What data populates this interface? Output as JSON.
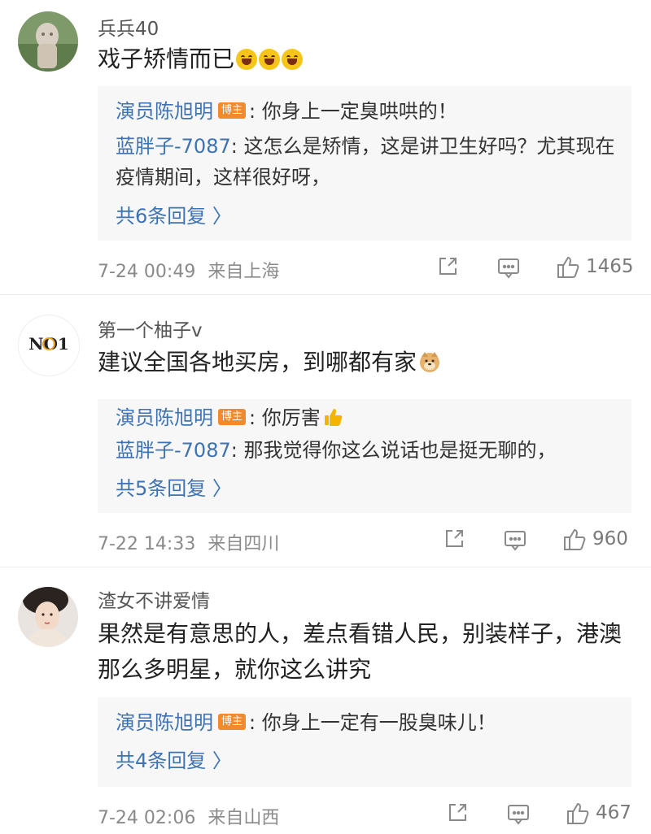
{
  "comments": [
    {
      "username": "兵兵40",
      "text": "戏子矫情而已",
      "emojis": [
        "laughing-face-icon",
        "laughing-face-icon",
        "laughing-face-icon"
      ],
      "replies": [
        {
          "author": "演员陈旭明",
          "badge": "博主",
          "text": "你身上一定臭哄哄的！"
        },
        {
          "author": "蓝胖子-7087",
          "text": "这怎么是矫情，这是讲卫生好吗？尤其现在疫情期间，这样很好呀，"
        }
      ],
      "more_replies": "共6条回复 〉",
      "time": "7-24 00:49",
      "location": "来自上海",
      "likes": "1465"
    },
    {
      "username": "第一个柚子v",
      "text": "建议全国各地买房，到哪都有家",
      "emojis": [
        "doge-icon"
      ],
      "replies": [
        {
          "author": "演员陈旭明",
          "badge": "博主",
          "text": "你厉害",
          "emoji": "thumbs-up-icon"
        },
        {
          "author": "蓝胖子-7087",
          "text": "那我觉得你这么说话也是挺无聊的，"
        }
      ],
      "more_replies": "共5条回复 〉",
      "time": "7-22 14:33",
      "location": "来自四川",
      "likes": "960",
      "avatar_text": "NO1"
    },
    {
      "username": "渣女不讲爱情",
      "text": "果然是有意思的人，差点看错人民，别装样子，港澳那么多明星，就你这么讲究",
      "replies": [
        {
          "author": "演员陈旭明",
          "badge": "博主",
          "text": "你身上一定有一股臭味儿！"
        }
      ],
      "more_replies": "共4条回复 〉",
      "time": "7-24 02:06",
      "location": "来自山西",
      "likes": "467"
    }
  ],
  "colors": {
    "link": "#3d73b3",
    "badge": "#f28a2b",
    "reply_bg": "#f7f7f7",
    "meta": "#8a8a8a"
  }
}
